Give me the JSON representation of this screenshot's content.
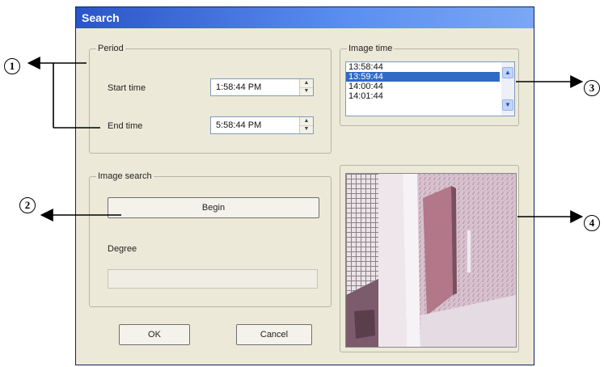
{
  "dialog": {
    "title": "Search"
  },
  "period": {
    "legend": "Period",
    "start_label": "Start time",
    "start_value": "1:58:44 PM",
    "end_label": "End time",
    "end_value": "5:58:44 PM"
  },
  "image_search": {
    "legend": "Image search",
    "begin_label": "Begin",
    "degree_label": "Degree",
    "degree_progress": 0
  },
  "image_time": {
    "legend": "Image time",
    "items": [
      "13:58:44",
      "13:59:44",
      "14:00:44",
      "14:01:44"
    ],
    "selected_index": 1
  },
  "buttons": {
    "ok": "OK",
    "cancel": "Cancel"
  },
  "callouts": [
    "1",
    "2",
    "3",
    "4"
  ],
  "icons": {
    "spin_up": "spin-up-arrow",
    "spin_down": "spin-down-arrow",
    "scroll_up": "chevron-up",
    "scroll_down": "chevron-down"
  },
  "colors": {
    "title_bar": "#2a55c8",
    "selection": "#316ac5",
    "dialog_bg": "#ece9d8"
  }
}
